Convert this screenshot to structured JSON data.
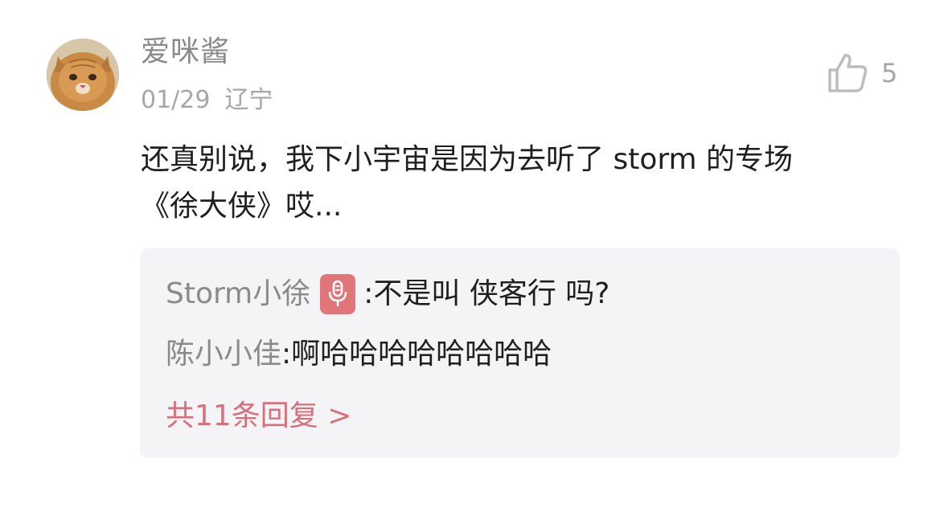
{
  "comment": {
    "username": "爱咪酱",
    "date": "01/29",
    "location": "辽宁",
    "like_count": "5",
    "text_line1": "还真别说，我下小宇宙是因为去听了 storm 的专场",
    "text_line2": "《徐大侠》哎..."
  },
  "replies": [
    {
      "author": "Storm小徐",
      "separator": ": ",
      "content": "不是叫 侠客行 吗?",
      "badge_icon": "microphone-icon"
    },
    {
      "author": "陈小小佳",
      "separator": ": ",
      "content": "啊哈哈哈哈哈哈哈哈"
    }
  ],
  "more_replies_label": "共11条回复 >",
  "colors": {
    "accent": "#d8707b",
    "badge": "#e0757a",
    "reply_bg": "#f4f4f6",
    "muted_text": "#8a8a8a"
  }
}
